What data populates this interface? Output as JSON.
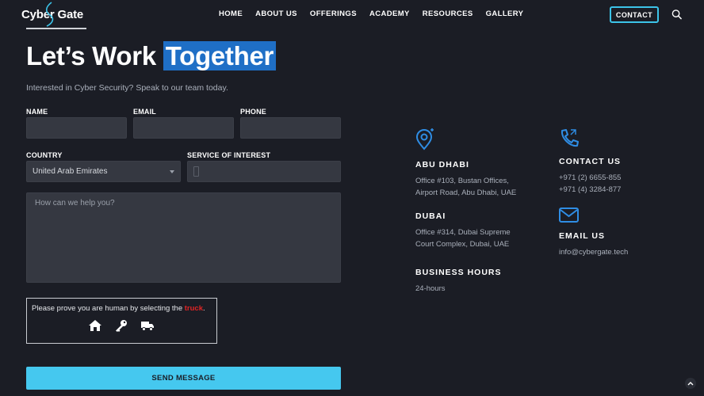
{
  "header": {
    "logo_text": "Cyber Gate",
    "nav": [
      "HOME",
      "ABOUT US",
      "OFFERINGS",
      "ACADEMY",
      "RESOURCES",
      "GALLERY"
    ],
    "contact_button": "CONTACT"
  },
  "form": {
    "title_plain": "Let’s Work ",
    "title_highlight": "Together",
    "subtitle": "Interested in Cyber Security? Speak to our team today.",
    "name_label": "NAME",
    "email_label": "EMAIL",
    "phone_label": "PHONE",
    "country_label": "COUNTRY",
    "country_value": "United Arab Emirates",
    "service_label": "SERVICE OF INTEREST",
    "message_placeholder": "How can we help you?",
    "captcha_prefix": "Please prove you are human by selecting the ",
    "captcha_target": "truck",
    "captcha_suffix": ".",
    "send_button": "SEND MESSAGE"
  },
  "contact_info": {
    "abu_dhabi_heading": "ABU DHABI",
    "abu_dhabi_line1": "Office #103, Bustan Offices,",
    "abu_dhabi_line2": "Airport Road, Abu Dhabi, UAE",
    "dubai_heading": "DUBAI",
    "dubai_line1": "Office #314, Dubai Supreme",
    "dubai_line2": "Court Complex, Dubai, UAE",
    "hours_heading": "BUSINESS HOURS",
    "hours_value": "24-hours",
    "contact_heading": "CONTACT US",
    "phone1": "+971 (2) 6655-855",
    "phone2": "+971 (4) 3284-877",
    "email_heading": "EMAIL US",
    "email_value": "info@cybergate.tech"
  },
  "colors": {
    "background": "#1b1d25",
    "accent": "#45c8ef",
    "highlight": "#1f6fc6",
    "icon_blue": "#2f8de4",
    "captcha_red": "#e02424"
  },
  "icons": {
    "location": "location-pin-icon",
    "phone": "phone-icon",
    "email": "envelope-icon",
    "search": "search-icon",
    "captcha": [
      "home-icon",
      "key-icon",
      "truck-icon"
    ],
    "scroll_top": "chevron-up-icon"
  }
}
